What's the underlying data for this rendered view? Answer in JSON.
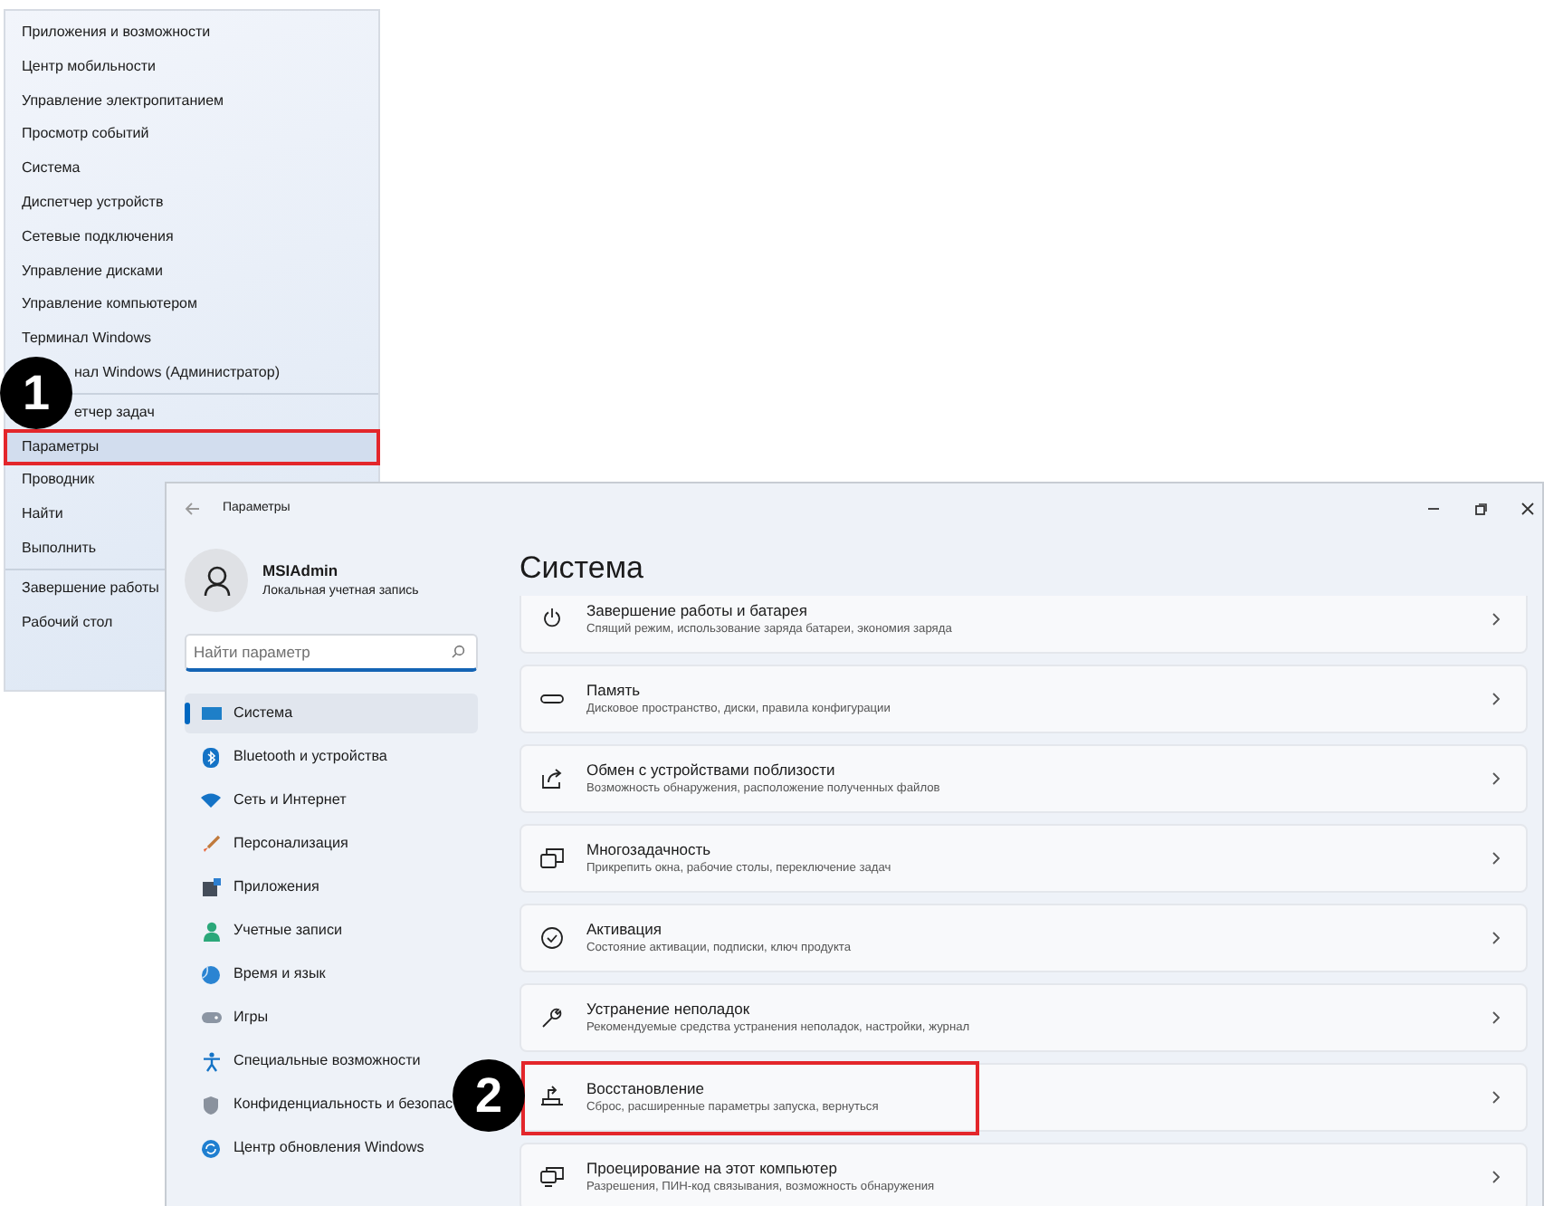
{
  "context_menu": {
    "groups": [
      {
        "items": [
          {
            "label": "Приложения и возможности",
            "kind": "item",
            "selected": false,
            "outlined": false
          },
          {
            "label": "Центр мобильности",
            "kind": "item",
            "selected": false,
            "outlined": false
          },
          {
            "label": "Управление электропитанием",
            "kind": "item",
            "selected": false,
            "outlined": false
          },
          {
            "label": "Просмотр событий",
            "kind": "item",
            "selected": false,
            "outlined": false
          },
          {
            "label": "Система",
            "kind": "item",
            "selected": false,
            "outlined": false
          },
          {
            "label": "Диспетчер устройств",
            "kind": "item",
            "selected": false,
            "outlined": false
          },
          {
            "label": "Сетевые подключения",
            "kind": "item",
            "selected": false,
            "outlined": false
          },
          {
            "label": "Управление дисками",
            "kind": "item",
            "selected": false,
            "outlined": false
          },
          {
            "label": "Управление компьютером",
            "kind": "item",
            "selected": false,
            "outlined": false
          },
          {
            "label": "Терминал Windows",
            "kind": "item",
            "selected": false,
            "outlined": false
          },
          {
            "label": "нал Windows (Администратор)",
            "kind": "partial",
            "selected": false,
            "outlined": false
          }
        ]
      },
      {
        "items": [
          {
            "label": "етчер задач",
            "kind": "partial",
            "selected": false,
            "outlined": false
          },
          {
            "label": "Параметры",
            "kind": "item",
            "selected": true,
            "outlined": true
          },
          {
            "label": "Проводник",
            "kind": "item",
            "selected": false,
            "outlined": false
          },
          {
            "label": "Найти",
            "kind": "item",
            "selected": false,
            "outlined": false
          },
          {
            "label": "Выполнить",
            "kind": "item",
            "selected": false,
            "outlined": false
          }
        ]
      },
      {
        "items": [
          {
            "label": "Завершение работы",
            "kind": "item",
            "selected": false,
            "outlined": false
          },
          {
            "label": "Рабочий стол",
            "kind": "item",
            "selected": false,
            "outlined": false
          }
        ]
      }
    ]
  },
  "settings": {
    "window": {
      "title": "Параметры"
    },
    "account": {
      "name": "MSIAdmin",
      "type": "Локальная учетная запись"
    },
    "search": {
      "placeholder": "Найти параметр"
    },
    "nav": [
      {
        "label": "Система",
        "selected": true
      },
      {
        "label": "Bluetooth и устройства",
        "selected": false
      },
      {
        "label": "Сеть и Интернет",
        "selected": false
      },
      {
        "label": "Персонализация",
        "selected": false
      },
      {
        "label": "Приложения",
        "selected": false
      },
      {
        "label": "Учетные записи",
        "selected": false
      },
      {
        "label": "Время и язык",
        "selected": false
      },
      {
        "label": "Игры",
        "selected": false
      },
      {
        "label": "Специальные возможности",
        "selected": false
      },
      {
        "label": "Конфиденциальность и безопас",
        "selected": false
      },
      {
        "label": "Центр обновления Windows",
        "selected": false
      }
    ],
    "page": {
      "title": "Система",
      "cards": [
        {
          "title": "Завершение работы и батарея",
          "subtitle": "Спящий режим, использование заряда батареи, экономия заряда",
          "outlined": false
        },
        {
          "title": "Память",
          "subtitle": "Дисковое пространство, диски, правила конфигурации",
          "outlined": false
        },
        {
          "title": "Обмен с устройствами поблизости",
          "subtitle": "Возможность обнаружения, расположение полученных файлов",
          "outlined": false
        },
        {
          "title": "Многозадачность",
          "subtitle": "Прикрепить окна, рабочие столы, переключение задач",
          "outlined": false
        },
        {
          "title": "Активация",
          "subtitle": "Состояние активации, подписки, ключ продукта",
          "outlined": false
        },
        {
          "title": "Устранение неполадок",
          "subtitle": "Рекомендуемые средства устранения неполадок, настройки, журнал",
          "outlined": false
        },
        {
          "title": "Восстановление",
          "subtitle": "Сброс, расширенные параметры запуска, вернуться",
          "outlined": true
        },
        {
          "title": "Проецирование на этот компьютер",
          "subtitle": "Разрешения, ПИН-код связывания, возможность обнаружения",
          "outlined": false
        }
      ]
    }
  },
  "callouts": [
    {
      "label": "1"
    },
    {
      "label": "2"
    }
  ]
}
